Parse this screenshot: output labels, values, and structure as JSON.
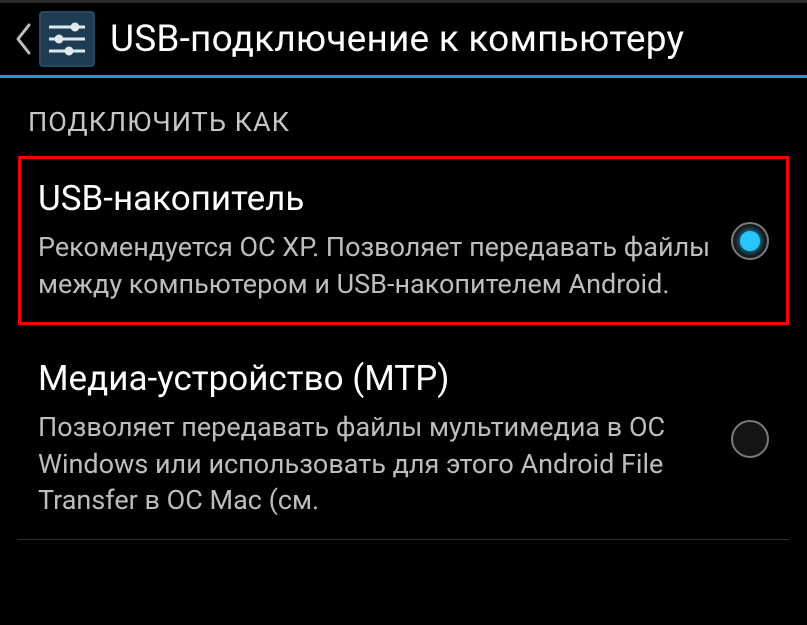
{
  "header": {
    "title": "USB-подключение к компьютеру"
  },
  "section": {
    "label": "ПОДКЛЮЧИТЬ КАК"
  },
  "options": [
    {
      "title": "USB-накопитель",
      "desc": "Рекомендуется ОС XP. Позволяет передавать файлы между компьютером и USB-накопителем Android.",
      "selected": true
    },
    {
      "title": "Медиа-устройство (MTP)",
      "desc": "Позволяет передавать файлы мультимедиа в ОС Windows или использовать для этого Android File Transfer в ОС Mac (см.",
      "selected": false
    }
  ]
}
